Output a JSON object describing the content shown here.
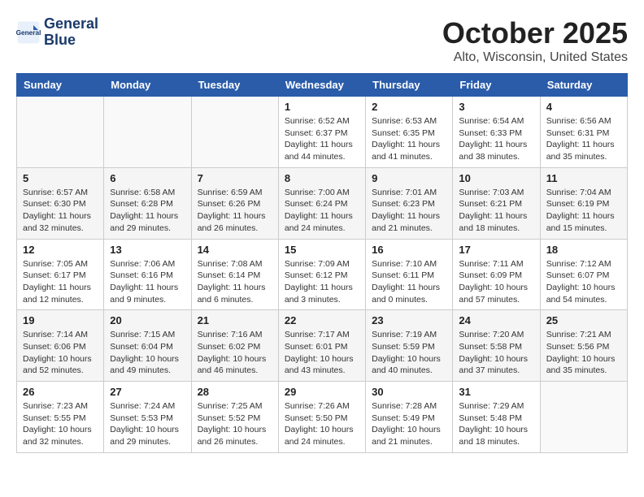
{
  "header": {
    "logo_line1": "General",
    "logo_line2": "Blue",
    "month": "October 2025",
    "location": "Alto, Wisconsin, United States"
  },
  "weekdays": [
    "Sunday",
    "Monday",
    "Tuesday",
    "Wednesday",
    "Thursday",
    "Friday",
    "Saturday"
  ],
  "weeks": [
    [
      {
        "day": "",
        "info": ""
      },
      {
        "day": "",
        "info": ""
      },
      {
        "day": "",
        "info": ""
      },
      {
        "day": "1",
        "info": "Sunrise: 6:52 AM\nSunset: 6:37 PM\nDaylight: 11 hours and 44 minutes."
      },
      {
        "day": "2",
        "info": "Sunrise: 6:53 AM\nSunset: 6:35 PM\nDaylight: 11 hours and 41 minutes."
      },
      {
        "day": "3",
        "info": "Sunrise: 6:54 AM\nSunset: 6:33 PM\nDaylight: 11 hours and 38 minutes."
      },
      {
        "day": "4",
        "info": "Sunrise: 6:56 AM\nSunset: 6:31 PM\nDaylight: 11 hours and 35 minutes."
      }
    ],
    [
      {
        "day": "5",
        "info": "Sunrise: 6:57 AM\nSunset: 6:30 PM\nDaylight: 11 hours and 32 minutes."
      },
      {
        "day": "6",
        "info": "Sunrise: 6:58 AM\nSunset: 6:28 PM\nDaylight: 11 hours and 29 minutes."
      },
      {
        "day": "7",
        "info": "Sunrise: 6:59 AM\nSunset: 6:26 PM\nDaylight: 11 hours and 26 minutes."
      },
      {
        "day": "8",
        "info": "Sunrise: 7:00 AM\nSunset: 6:24 PM\nDaylight: 11 hours and 24 minutes."
      },
      {
        "day": "9",
        "info": "Sunrise: 7:01 AM\nSunset: 6:23 PM\nDaylight: 11 hours and 21 minutes."
      },
      {
        "day": "10",
        "info": "Sunrise: 7:03 AM\nSunset: 6:21 PM\nDaylight: 11 hours and 18 minutes."
      },
      {
        "day": "11",
        "info": "Sunrise: 7:04 AM\nSunset: 6:19 PM\nDaylight: 11 hours and 15 minutes."
      }
    ],
    [
      {
        "day": "12",
        "info": "Sunrise: 7:05 AM\nSunset: 6:17 PM\nDaylight: 11 hours and 12 minutes."
      },
      {
        "day": "13",
        "info": "Sunrise: 7:06 AM\nSunset: 6:16 PM\nDaylight: 11 hours and 9 minutes."
      },
      {
        "day": "14",
        "info": "Sunrise: 7:08 AM\nSunset: 6:14 PM\nDaylight: 11 hours and 6 minutes."
      },
      {
        "day": "15",
        "info": "Sunrise: 7:09 AM\nSunset: 6:12 PM\nDaylight: 11 hours and 3 minutes."
      },
      {
        "day": "16",
        "info": "Sunrise: 7:10 AM\nSunset: 6:11 PM\nDaylight: 11 hours and 0 minutes."
      },
      {
        "day": "17",
        "info": "Sunrise: 7:11 AM\nSunset: 6:09 PM\nDaylight: 10 hours and 57 minutes."
      },
      {
        "day": "18",
        "info": "Sunrise: 7:12 AM\nSunset: 6:07 PM\nDaylight: 10 hours and 54 minutes."
      }
    ],
    [
      {
        "day": "19",
        "info": "Sunrise: 7:14 AM\nSunset: 6:06 PM\nDaylight: 10 hours and 52 minutes."
      },
      {
        "day": "20",
        "info": "Sunrise: 7:15 AM\nSunset: 6:04 PM\nDaylight: 10 hours and 49 minutes."
      },
      {
        "day": "21",
        "info": "Sunrise: 7:16 AM\nSunset: 6:02 PM\nDaylight: 10 hours and 46 minutes."
      },
      {
        "day": "22",
        "info": "Sunrise: 7:17 AM\nSunset: 6:01 PM\nDaylight: 10 hours and 43 minutes."
      },
      {
        "day": "23",
        "info": "Sunrise: 7:19 AM\nSunset: 5:59 PM\nDaylight: 10 hours and 40 minutes."
      },
      {
        "day": "24",
        "info": "Sunrise: 7:20 AM\nSunset: 5:58 PM\nDaylight: 10 hours and 37 minutes."
      },
      {
        "day": "25",
        "info": "Sunrise: 7:21 AM\nSunset: 5:56 PM\nDaylight: 10 hours and 35 minutes."
      }
    ],
    [
      {
        "day": "26",
        "info": "Sunrise: 7:23 AM\nSunset: 5:55 PM\nDaylight: 10 hours and 32 minutes."
      },
      {
        "day": "27",
        "info": "Sunrise: 7:24 AM\nSunset: 5:53 PM\nDaylight: 10 hours and 29 minutes."
      },
      {
        "day": "28",
        "info": "Sunrise: 7:25 AM\nSunset: 5:52 PM\nDaylight: 10 hours and 26 minutes."
      },
      {
        "day": "29",
        "info": "Sunrise: 7:26 AM\nSunset: 5:50 PM\nDaylight: 10 hours and 24 minutes."
      },
      {
        "day": "30",
        "info": "Sunrise: 7:28 AM\nSunset: 5:49 PM\nDaylight: 10 hours and 21 minutes."
      },
      {
        "day": "31",
        "info": "Sunrise: 7:29 AM\nSunset: 5:48 PM\nDaylight: 10 hours and 18 minutes."
      },
      {
        "day": "",
        "info": ""
      }
    ]
  ]
}
